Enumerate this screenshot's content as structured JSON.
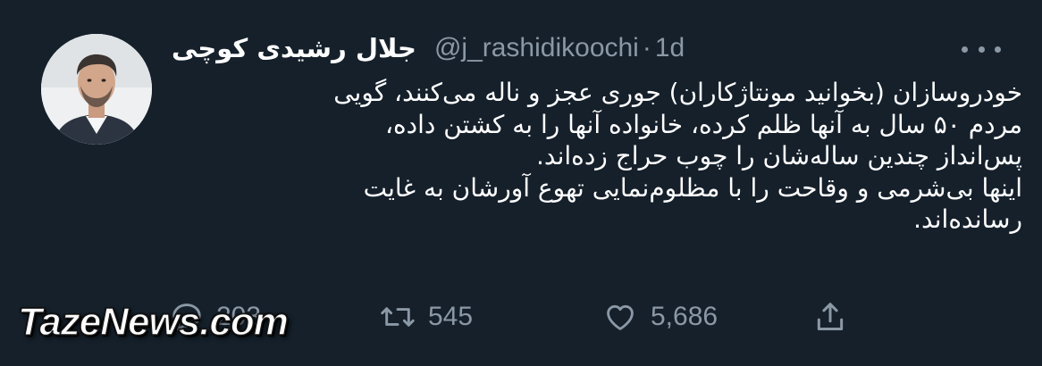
{
  "tweet": {
    "author": {
      "display_name": "جلال رشیدی کوچی",
      "handle": "@j_rashidikoochi",
      "separator": "·",
      "time": "1d",
      "avatar_icon": "avatar-photo"
    },
    "more_icon": "more-dots-icon",
    "text_lines": [
      "خودروسازان (بخوانید مونتاژکاران) جوری عجز و ناله می‌کنند، گویی",
      "مردم ۵۰ سال به آنها ظلم کرده، خانواده آنها را به کشتن داده،",
      "پس‌انداز چندین ساله‌شان را چوب حراج زده‌اند.",
      "اینها بی‌شرمی و وقاحت را با مظلوم‌نمایی تهوع آورشان به غایت",
      "رسانده‌اند."
    ],
    "actions": {
      "reply": {
        "icon": "reply-icon",
        "count": "203"
      },
      "retweet": {
        "icon": "retweet-icon",
        "count": "545"
      },
      "like": {
        "icon": "heart-icon",
        "count": "5,686"
      },
      "share": {
        "icon": "share-icon"
      }
    }
  },
  "watermark": "TazeNews.com",
  "colors": {
    "background": "#15202b",
    "primary_text": "#ffffff",
    "secondary_text": "#8b98a5"
  }
}
